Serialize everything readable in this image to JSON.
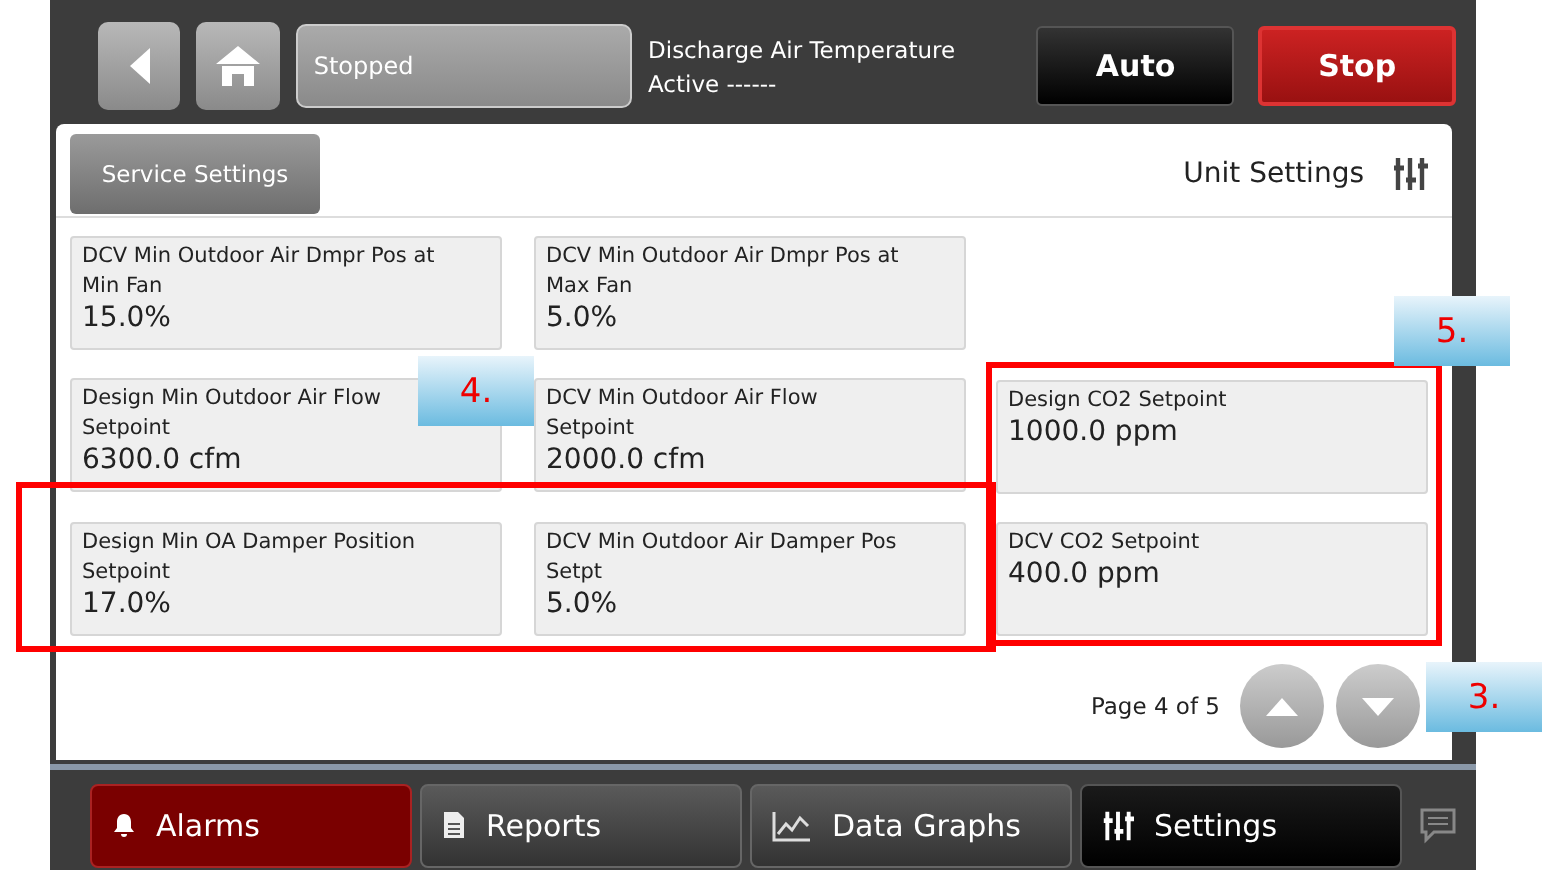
{
  "top_bar": {
    "status": "Stopped",
    "info_lines": [
      "Discharge Air Temperature",
      "Active ------"
    ],
    "mode_buttons": [
      {
        "label": "Auto",
        "kind": "dark"
      },
      {
        "label": "Stop",
        "kind": "red"
      }
    ]
  },
  "panel": {
    "service_button": "Service Settings",
    "title": "Unit Settings",
    "cards": [
      {
        "label": "DCV Min Outdoor Air Dmpr Pos at Min Fan",
        "value": "15.0%"
      },
      {
        "label": "DCV Min Outdoor Air Dmpr Pos at Max Fan",
        "value": "5.0%"
      },
      {
        "label": "Design Min Outdoor Air Flow Setpoint",
        "value": "6300.0 cfm"
      },
      {
        "label": "DCV Min Outdoor Air Flow Setpoint",
        "value": "2000.0 cfm"
      },
      {
        "label": "Design Min OA Damper Position Setpoint",
        "value": "17.0%"
      },
      {
        "label": "DCV Min Outdoor Air Damper Pos Setpt",
        "value": "5.0%"
      }
    ],
    "side_cards": [
      {
        "label": "Design CO2 Setpoint",
        "value": "1000.0 ppm"
      },
      {
        "label": "DCV CO2 Setpoint",
        "value": "400.0 ppm"
      }
    ],
    "page": "Page 4 of 5"
  },
  "nav_tabs": [
    {
      "label": "Alarms",
      "kind": "alarm",
      "selected": false,
      "alert": true
    },
    {
      "label": "Reports",
      "kind": "report",
      "selected": false,
      "alert": false
    },
    {
      "label": "Data Graphs",
      "kind": "graph",
      "selected": false,
      "alert": false
    },
    {
      "label": "Settings",
      "kind": "settings",
      "selected": true,
      "alert": false
    }
  ],
  "annotations": [
    {
      "label": "4."
    },
    {
      "label": "5."
    },
    {
      "label": "3."
    }
  ]
}
